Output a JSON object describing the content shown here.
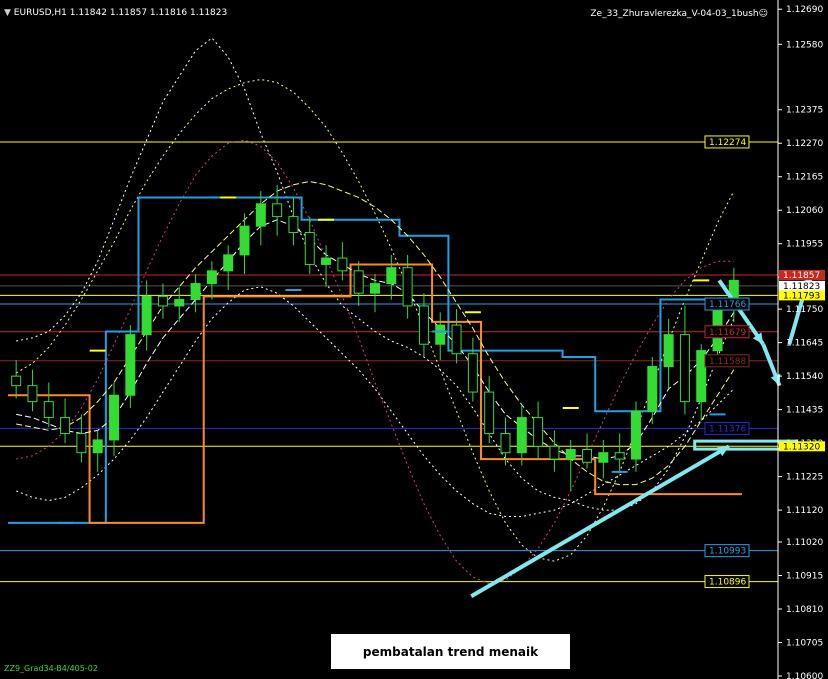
{
  "header": {
    "symbol_info": "EURUSD,H1  1.11842 1.11857 1.11816 1.11823",
    "indicator_name": "Ze_33_Zhuravlerezka_V-04-03_1bush",
    "footer_text": "ZZ9_Grad34-B4/405-02"
  },
  "annotation": {
    "text": "pembatalan trend menaik"
  },
  "colors": {
    "background": "#000000",
    "candle": "#32dc32",
    "cyan_line": "#1ea0e6",
    "orange_line": "#ff8a1e",
    "yellow": "#ffff00",
    "arrow": "#7fe8f0",
    "red_level": "#c8281e",
    "blue_level": "#2828dc"
  },
  "chart_data": {
    "type": "line",
    "title": "EURUSD,H1",
    "ylim": [
      1.106,
      1.1265
    ],
    "y_ticks": [
      "1.12690",
      "1.12580",
      "1.12375",
      "1.12270",
      "1.12165",
      "1.12060",
      "1.11955",
      "1.11850",
      "1.11750",
      "1.11645",
      "1.11540",
      "1.11435",
      "1.11330",
      "1.11225",
      "1.11120",
      "1.11020",
      "1.10915",
      "1.10810",
      "1.10705",
      "1.10600"
    ],
    "levels": [
      {
        "label": "1.12274",
        "value": 1.12274,
        "color": "#ffff00",
        "text_color": "#ffff00"
      },
      {
        "label": "1.11857",
        "value": 1.11857,
        "color": "#c8281e",
        "text_color": "#ffffff",
        "bg": "#c8281e"
      },
      {
        "label": "1.11823",
        "value": 1.11823,
        "color": "#555555",
        "text_color": "#000000",
        "bg": "#ffffff"
      },
      {
        "label": "1.11793",
        "value": 1.11793,
        "color": "#ffff00",
        "text_color": "#000000",
        "bg": "#ffff00"
      },
      {
        "label": "1.11766",
        "value": 1.11766,
        "color": "#1ea0e6",
        "text_color": "#1ea0e6"
      },
      {
        "label": "1.11679",
        "value": 1.11679,
        "color": "#c8281e",
        "text_color": "#c8281e"
      },
      {
        "label": "1.11588",
        "value": 1.11588,
        "color": "#8b2a1e",
        "text_color": "#8b2a1e"
      },
      {
        "label": "1.11376",
        "value": 1.11376,
        "color": "#2828dc",
        "text_color": "#2828dc"
      },
      {
        "label": "1.11320",
        "value": 1.1132,
        "color": "#ffff00",
        "text_color": "#000000",
        "bg": "#ffff00"
      },
      {
        "label": "1.10993",
        "value": 1.10993,
        "color": "#1ea0e6",
        "text_color": "#1ea0e6"
      },
      {
        "label": "1.10896",
        "value": 1.10896,
        "color": "#ffff00",
        "text_color": "#ffff00"
      }
    ],
    "candles": [
      {
        "o": 1.1154,
        "h": 1.1159,
        "l": 1.1147,
        "c": 1.1151
      },
      {
        "o": 1.1151,
        "h": 1.1156,
        "l": 1.1143,
        "c": 1.1146
      },
      {
        "o": 1.1146,
        "h": 1.1152,
        "l": 1.1138,
        "c": 1.1141
      },
      {
        "o": 1.1141,
        "h": 1.1147,
        "l": 1.1133,
        "c": 1.1136
      },
      {
        "o": 1.1136,
        "h": 1.1142,
        "l": 1.1127,
        "c": 1.113
      },
      {
        "o": 1.113,
        "h": 1.1137,
        "l": 1.1124,
        "c": 1.1134
      },
      {
        "o": 1.1134,
        "h": 1.1152,
        "l": 1.1129,
        "c": 1.1148
      },
      {
        "o": 1.1148,
        "h": 1.117,
        "l": 1.1144,
        "c": 1.1167
      },
      {
        "o": 1.1167,
        "h": 1.1184,
        "l": 1.1162,
        "c": 1.1179
      },
      {
        "o": 1.1179,
        "h": 1.1183,
        "l": 1.1172,
        "c": 1.1176
      },
      {
        "o": 1.1176,
        "h": 1.1182,
        "l": 1.1171,
        "c": 1.1178
      },
      {
        "o": 1.1178,
        "h": 1.1186,
        "l": 1.1174,
        "c": 1.1183
      },
      {
        "o": 1.1183,
        "h": 1.119,
        "l": 1.1178,
        "c": 1.1187
      },
      {
        "o": 1.1187,
        "h": 1.1195,
        "l": 1.1181,
        "c": 1.1192
      },
      {
        "o": 1.1192,
        "h": 1.1205,
        "l": 1.1186,
        "c": 1.1201
      },
      {
        "o": 1.1201,
        "h": 1.1212,
        "l": 1.1195,
        "c": 1.1208
      },
      {
        "o": 1.1208,
        "h": 1.1214,
        "l": 1.1198,
        "c": 1.1204
      },
      {
        "o": 1.1204,
        "h": 1.121,
        "l": 1.1195,
        "c": 1.1199
      },
      {
        "o": 1.1199,
        "h": 1.1204,
        "l": 1.1186,
        "c": 1.1189
      },
      {
        "o": 1.1189,
        "h": 1.1195,
        "l": 1.1182,
        "c": 1.1191
      },
      {
        "o": 1.1191,
        "h": 1.1196,
        "l": 1.1184,
        "c": 1.1187
      },
      {
        "o": 1.1187,
        "h": 1.119,
        "l": 1.1176,
        "c": 1.118
      },
      {
        "o": 1.118,
        "h": 1.1186,
        "l": 1.1174,
        "c": 1.1183
      },
      {
        "o": 1.1183,
        "h": 1.1192,
        "l": 1.1178,
        "c": 1.1188
      },
      {
        "o": 1.1188,
        "h": 1.1192,
        "l": 1.1172,
        "c": 1.1176
      },
      {
        "o": 1.1176,
        "h": 1.118,
        "l": 1.116,
        "c": 1.1164
      },
      {
        "o": 1.1164,
        "h": 1.1174,
        "l": 1.1159,
        "c": 1.117
      },
      {
        "o": 1.117,
        "h": 1.1175,
        "l": 1.1158,
        "c": 1.1161
      },
      {
        "o": 1.1161,
        "h": 1.1166,
        "l": 1.1146,
        "c": 1.1149
      },
      {
        "o": 1.1149,
        "h": 1.1154,
        "l": 1.1133,
        "c": 1.1136
      },
      {
        "o": 1.1136,
        "h": 1.1141,
        "l": 1.1126,
        "c": 1.113
      },
      {
        "o": 1.113,
        "h": 1.1145,
        "l": 1.1126,
        "c": 1.1141
      },
      {
        "o": 1.1141,
        "h": 1.1146,
        "l": 1.1128,
        "c": 1.1132
      },
      {
        "o": 1.1132,
        "h": 1.1137,
        "l": 1.1124,
        "c": 1.1128
      },
      {
        "o": 1.1128,
        "h": 1.1134,
        "l": 1.1118,
        "c": 1.1131
      },
      {
        "o": 1.1131,
        "h": 1.1136,
        "l": 1.1125,
        "c": 1.1127
      },
      {
        "o": 1.1127,
        "h": 1.1134,
        "l": 1.1122,
        "c": 1.113
      },
      {
        "o": 1.113,
        "h": 1.1136,
        "l": 1.1124,
        "c": 1.1128
      },
      {
        "o": 1.1128,
        "h": 1.1146,
        "l": 1.1124,
        "c": 1.1143
      },
      {
        "o": 1.1143,
        "h": 1.116,
        "l": 1.1139,
        "c": 1.1157
      },
      {
        "o": 1.1157,
        "h": 1.1172,
        "l": 1.115,
        "c": 1.1167
      },
      {
        "o": 1.1167,
        "h": 1.1176,
        "l": 1.1142,
        "c": 1.1146
      },
      {
        "o": 1.1146,
        "h": 1.1164,
        "l": 1.114,
        "c": 1.1162
      },
      {
        "o": 1.1162,
        "h": 1.1178,
        "l": 1.1158,
        "c": 1.1175
      },
      {
        "o": 1.1175,
        "h": 1.1188,
        "l": 1.1171,
        "c": 1.1184
      }
    ],
    "line_series": [
      {
        "color": "#1ea0e6",
        "values": [
          1.1108,
          1.1108,
          1.1108,
          1.1108,
          1.1108,
          1.1108,
          1.1168,
          1.1168,
          1.121,
          1.121,
          1.121,
          1.121,
          1.121,
          1.121,
          1.121,
          1.121,
          1.121,
          1.121,
          1.1203,
          1.1203,
          1.1203,
          1.1203,
          1.1203,
          1.1203,
          1.1198,
          1.1198,
          1.1198,
          1.1162,
          1.1162,
          1.1162,
          1.1162,
          1.1162,
          1.1162,
          1.1162,
          1.116,
          1.116,
          1.1143,
          1.1143,
          1.1143,
          1.1143,
          1.1178,
          1.1178,
          1.1178,
          1.1178,
          1.1178
        ]
      },
      {
        "color": "#ff8a1e",
        "values": [
          1.1148,
          1.1148,
          1.1148,
          1.1148,
          1.1148,
          1.1108,
          1.1108,
          1.1108,
          1.1108,
          1.1108,
          1.1108,
          1.1108,
          1.1179,
          1.1179,
          1.1179,
          1.1179,
          1.1179,
          1.1179,
          1.1179,
          1.1179,
          1.1179,
          1.1189,
          1.1189,
          1.1189,
          1.1189,
          1.1189,
          1.1171,
          1.1171,
          1.1171,
          1.1128,
          1.1128,
          1.1128,
          1.1128,
          1.1128,
          1.1128,
          1.1128,
          1.1117,
          1.1117,
          1.1117,
          1.1117,
          1.1117,
          1.1117,
          1.1117,
          1.1117,
          1.1117
        ]
      },
      {
        "color": "#ffffff",
        "values": [
          1.1142,
          1.1141,
          1.1139,
          1.1137,
          1.1136,
          1.1137,
          1.1141,
          1.1149,
          1.1158,
          1.1166,
          1.1172,
          1.1178,
          1.1184,
          1.119,
          1.1196,
          1.1201,
          1.1203,
          1.1201,
          1.1197,
          1.1192,
          1.1189,
          1.1186,
          1.1184,
          1.1183,
          1.118,
          1.1174,
          1.1169,
          1.1164,
          1.1157,
          1.1149,
          1.1142,
          1.1138,
          1.1134,
          1.1131,
          1.1129,
          1.1129,
          1.1128,
          1.1129,
          1.1133,
          1.1141,
          1.115,
          1.1154,
          1.1159,
          1.1166,
          1.1174
        ]
      },
      {
        "color": "#ffff66",
        "values": [
          1.1139,
          1.1138,
          1.1137,
          1.1138,
          1.1141,
          1.1146,
          1.1152,
          1.116,
          1.1168,
          1.1176,
          1.1182,
          1.1188,
          1.1193,
          1.1198,
          1.1203,
          1.1208,
          1.1212,
          1.1214,
          1.1215,
          1.1214,
          1.1212,
          1.121,
          1.1207,
          1.1203,
          1.1198,
          1.1192,
          1.1185,
          1.1177,
          1.1169,
          1.116,
          1.1152,
          1.1145,
          1.1139,
          1.1133,
          1.1128,
          1.1124,
          1.1121,
          1.112,
          1.112,
          1.1122,
          1.1126,
          1.1132,
          1.114,
          1.1148,
          1.1156
        ]
      }
    ],
    "dotted_series": [
      {
        "color": "#ffffff",
        "values": [
          1.1165,
          1.1166,
          1.1168,
          1.1173,
          1.118,
          1.119,
          1.1203,
          1.1216,
          1.1228,
          1.124,
          1.1248,
          1.1256,
          1.126,
          1.1254,
          1.1244,
          1.123,
          1.1218,
          1.1204,
          1.1192,
          1.1183,
          1.1176,
          1.1172,
          1.1168,
          1.1165,
          1.1163,
          1.116,
          1.1156,
          1.1151,
          1.1144,
          1.1136,
          1.1128,
          1.1122,
          1.1118,
          1.1116,
          1.1115,
          1.1113,
          1.1112,
          1.1112,
          1.1114,
          1.1118,
          1.1125,
          1.1135,
          1.1147,
          1.116,
          1.1172
        ]
      },
      {
        "color": "#ffffff",
        "values": [
          1.1118,
          1.1116,
          1.1115,
          1.1116,
          1.1119,
          1.1123,
          1.1128,
          1.1134,
          1.1141,
          1.1149,
          1.1157,
          1.1165,
          1.1172,
          1.1177,
          1.1181,
          1.1182,
          1.118,
          1.1176,
          1.1171,
          1.1166,
          1.1161,
          1.1156,
          1.115,
          1.1143,
          1.1136,
          1.1129,
          1.1123,
          1.1118,
          1.1114,
          1.1111,
          1.111,
          1.111,
          1.1111,
          1.1112,
          1.1114,
          1.1117,
          1.112,
          1.1123,
          1.1126,
          1.1129,
          1.1132,
          1.1136,
          1.114,
          1.1145,
          1.115
        ]
      },
      {
        "color": "#ffff66",
        "values": [
          1.1155,
          1.1158,
          1.1163,
          1.117,
          1.1178,
          1.1187,
          1.1196,
          1.1206,
          1.1215,
          1.1223,
          1.123,
          1.1236,
          1.1241,
          1.1244,
          1.1246,
          1.1247,
          1.1246,
          1.1243,
          1.1238,
          1.1232,
          1.1224,
          1.1215,
          1.1205,
          1.1194,
          1.1182,
          1.1169,
          1.1156,
          1.1143,
          1.113,
          1.1118,
          1.1108,
          1.1101,
          1.1097,
          1.1096,
          1.1098,
          1.1104,
          1.1113,
          1.1124,
          1.1137,
          1.1151,
          1.1165,
          1.1178,
          1.119,
          1.1202,
          1.1212
        ]
      },
      {
        "color": "#dc3c78",
        "values": [
          1.1128,
          1.1129,
          1.1132,
          1.1137,
          1.1144,
          1.1153,
          1.1164,
          1.1175,
          1.1187,
          1.1198,
          1.1208,
          1.1217,
          1.1223,
          1.1227,
          1.1228,
          1.1226,
          1.1221,
          1.1213,
          1.1203,
          1.1191,
          1.1179,
          1.1166,
          1.1152,
          1.1139,
          1.1126,
          1.1114,
          1.1104,
          1.1096,
          1.1091,
          1.1089,
          1.109,
          1.1094,
          1.11,
          1.1108,
          1.1118,
          1.1129,
          1.114,
          1.1151,
          1.1161,
          1.117,
          1.1178,
          1.1184,
          1.1188,
          1.119,
          1.119
        ]
      }
    ],
    "markers": [
      {
        "color": "#ffff00",
        "x": 5,
        "y": 1.1162
      },
      {
        "color": "#ffff00",
        "x": 13,
        "y": 1.121
      },
      {
        "color": "#ffff00",
        "x": 19,
        "y": 1.1203
      },
      {
        "color": "#ffff00",
        "x": 28,
        "y": 1.1174
      },
      {
        "color": "#ffff00",
        "x": 34,
        "y": 1.1144
      },
      {
        "color": "#ffff00",
        "x": 42,
        "y": 1.1184
      },
      {
        "color": "#1ea0e6",
        "x": 3,
        "y": 1.1108
      },
      {
        "color": "#1ea0e6",
        "x": 17,
        "y": 1.1181
      },
      {
        "color": "#1ea0e6",
        "x": 26,
        "y": 1.1168
      },
      {
        "color": "#1ea0e6",
        "x": 37,
        "y": 1.1124
      },
      {
        "color": "#1ea0e6",
        "x": 43,
        "y": 1.1142
      }
    ],
    "arrows": [
      {
        "from": [
          43.1,
          1.1184
        ],
        "to": [
          45.8,
          1.1164
        ]
      },
      {
        "from": [
          45.8,
          1.1164
        ],
        "to": [
          46.8,
          1.1151
        ]
      },
      {
        "from": [
          47.4,
          1.1164
        ],
        "to": [
          48.7,
          1.1187
        ]
      },
      {
        "from": [
          27.9,
          1.1085
        ],
        "to": [
          43.7,
          1.1132
        ]
      }
    ],
    "box": {
      "x0": 41.6,
      "x1": 47.8,
      "y0": 1.1133,
      "y1": 1.113,
      "color": "#7fe8f0"
    }
  }
}
